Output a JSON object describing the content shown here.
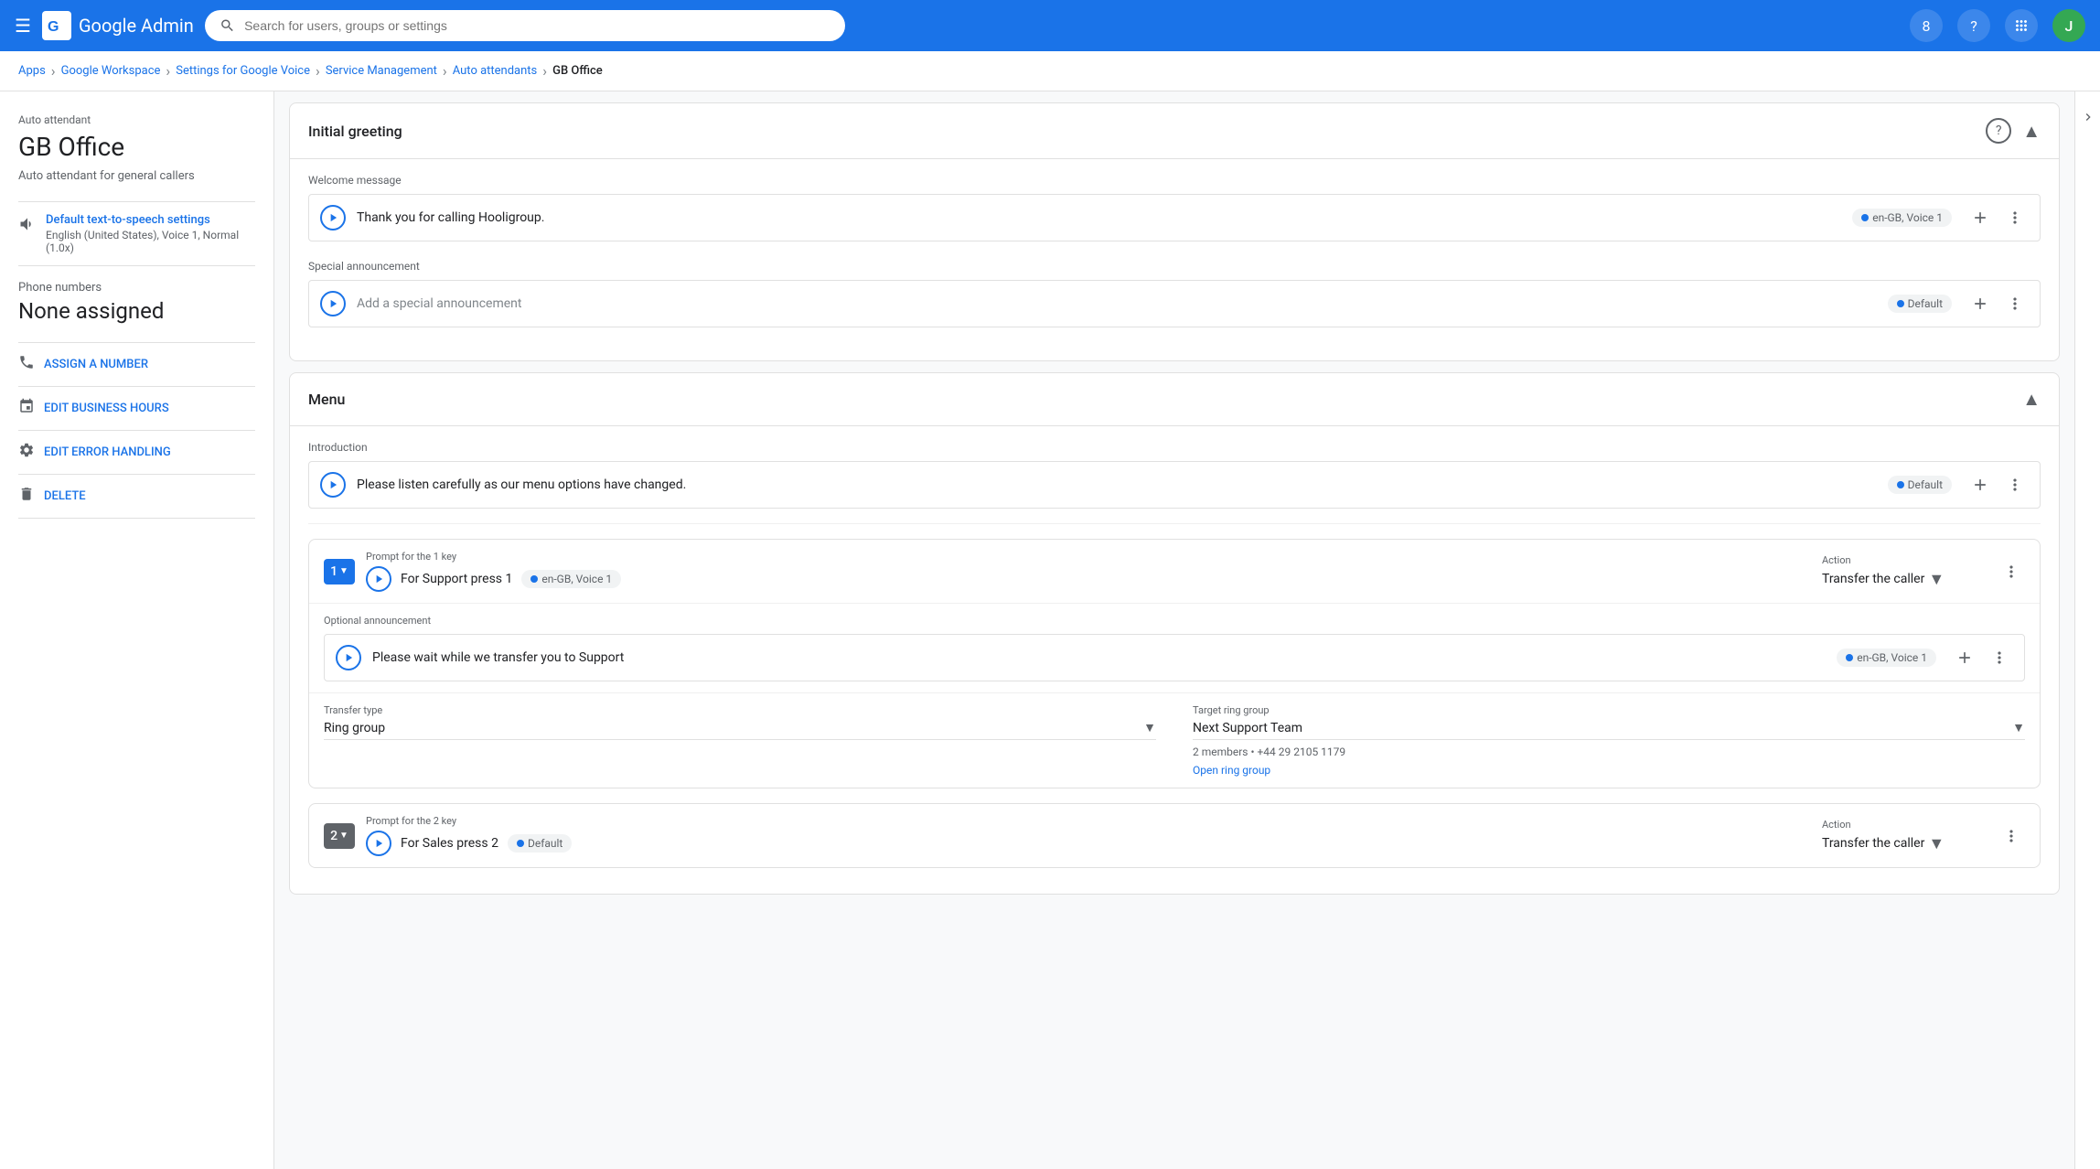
{
  "nav": {
    "menu_icon": "☰",
    "logo_text": "Google Admin",
    "search_placeholder": "Search for users, groups or settings",
    "help_badge": "?",
    "apps_icon": "⋮⋮⋮",
    "avatar_letter": "J"
  },
  "breadcrumb": {
    "items": [
      "Apps",
      "Google Workspace",
      "Settings for Google Voice",
      "Service Management",
      "Auto attendants",
      "GB Office"
    ]
  },
  "sidebar": {
    "label": "Auto attendant",
    "title": "GB Office",
    "subtitle": "Auto attendant for general callers",
    "tts_label": "Default text-to-speech settings",
    "tts_value": "English (United States), Voice 1, Normal (1.0x)",
    "phone_label": "Phone numbers",
    "phone_value": "None assigned",
    "actions": [
      {
        "id": "assign",
        "icon": "📞",
        "label": "ASSIGN A NUMBER"
      },
      {
        "id": "business-hours",
        "icon": "📅",
        "label": "EDIT BUSINESS HOURS"
      },
      {
        "id": "error-handling",
        "icon": "⚙",
        "label": "EDIT ERROR HANDLING"
      },
      {
        "id": "delete",
        "icon": "🗑",
        "label": "DELETE"
      }
    ]
  },
  "initial_greeting": {
    "title": "Initial greeting",
    "welcome_message_label": "Welcome message",
    "welcome_text": "Thank you for calling Hooligroup.",
    "welcome_voice": "en-GB, Voice 1",
    "special_announcement_label": "Special announcement",
    "special_placeholder": "Add a special announcement",
    "special_voice": "Default"
  },
  "menu": {
    "title": "Menu",
    "intro_label": "Introduction",
    "intro_text": "Please listen carefully as our menu options have changed.",
    "intro_voice": "Default",
    "key1": {
      "key": "1",
      "prompt_label": "Prompt for the 1 key",
      "prompt_text": "For Support press 1",
      "prompt_voice": "en-GB, Voice 1",
      "action_label": "Action",
      "action_value": "Transfer the caller",
      "optional_label": "Optional announcement",
      "optional_text": "Please wait while we transfer you to Support",
      "optional_voice": "en-GB, Voice 1",
      "transfer_type_label": "Transfer type",
      "transfer_type_value": "Ring group",
      "target_label": "Target ring group",
      "target_value": "Next Support Team",
      "ring_info": "2 members • +44 29 2105 1179",
      "open_ring_group": "Open ring group"
    },
    "key2": {
      "key": "2",
      "prompt_label": "Prompt for the 2 key",
      "prompt_text": "For Sales press 2",
      "prompt_voice": "Default",
      "action_label": "Action",
      "action_value": "Transfer the caller"
    }
  }
}
